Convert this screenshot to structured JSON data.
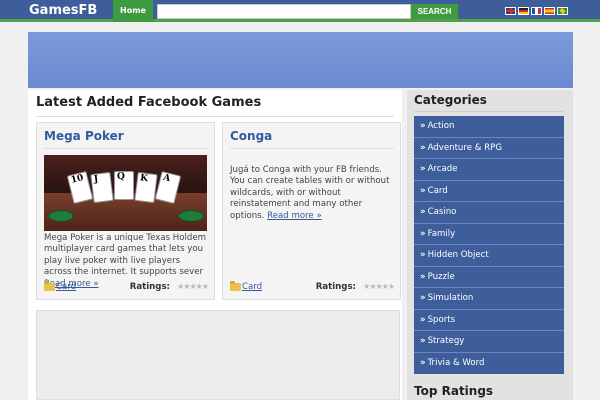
{
  "header": {
    "logo": "GamesFB",
    "home_label": "Home",
    "search_placeholder": "",
    "search_label": "SEARCH",
    "languages": [
      {
        "name": "english-flag",
        "color": "#2a3f8f"
      },
      {
        "name": "german-flag",
        "color": "#222222"
      },
      {
        "name": "french-flag",
        "color": "#2b4fa8"
      },
      {
        "name": "spanish-flag",
        "color": "#d0302b"
      },
      {
        "name": "portuguese-flag",
        "color": "#2f8c3d"
      }
    ]
  },
  "main": {
    "title": "Latest Added Facebook Games",
    "games": [
      {
        "title": "Mega Poker",
        "description": "Mega Poker is a unique Texas Holdem multiplayer card games that lets you play live poker with live players across the internet. It supports sever",
        "read_more": "Read more »",
        "category": "Card",
        "ratings_label": "Ratings:",
        "rating_stars": "★★★★★",
        "image_cards": [
          "10",
          "J",
          "Q",
          "K",
          "A"
        ]
      },
      {
        "title": "Conga",
        "description": "Jugá to Conga with your FB friends. You can create tables with or without wildcards, with or without reinstatement and many other options.",
        "read_more": "Read more »",
        "category": "Card",
        "ratings_label": "Ratings:",
        "rating_stars": "★★★★★"
      }
    ]
  },
  "sidebar": {
    "categories_title": "Categories",
    "categories": [
      "Action",
      "Adventure & RPG",
      "Arcade",
      "Card",
      "Casino",
      "Family",
      "Hidden Object",
      "Puzzle",
      "Simulation",
      "Sports",
      "Strategy",
      "Trivia & Word"
    ],
    "top_ratings_title": "Top Ratings",
    "bullet": "»"
  },
  "colors": {
    "header_bg": "#3d5e9b",
    "accent_green": "#3f9b3f",
    "link_blue": "#355a9b"
  }
}
